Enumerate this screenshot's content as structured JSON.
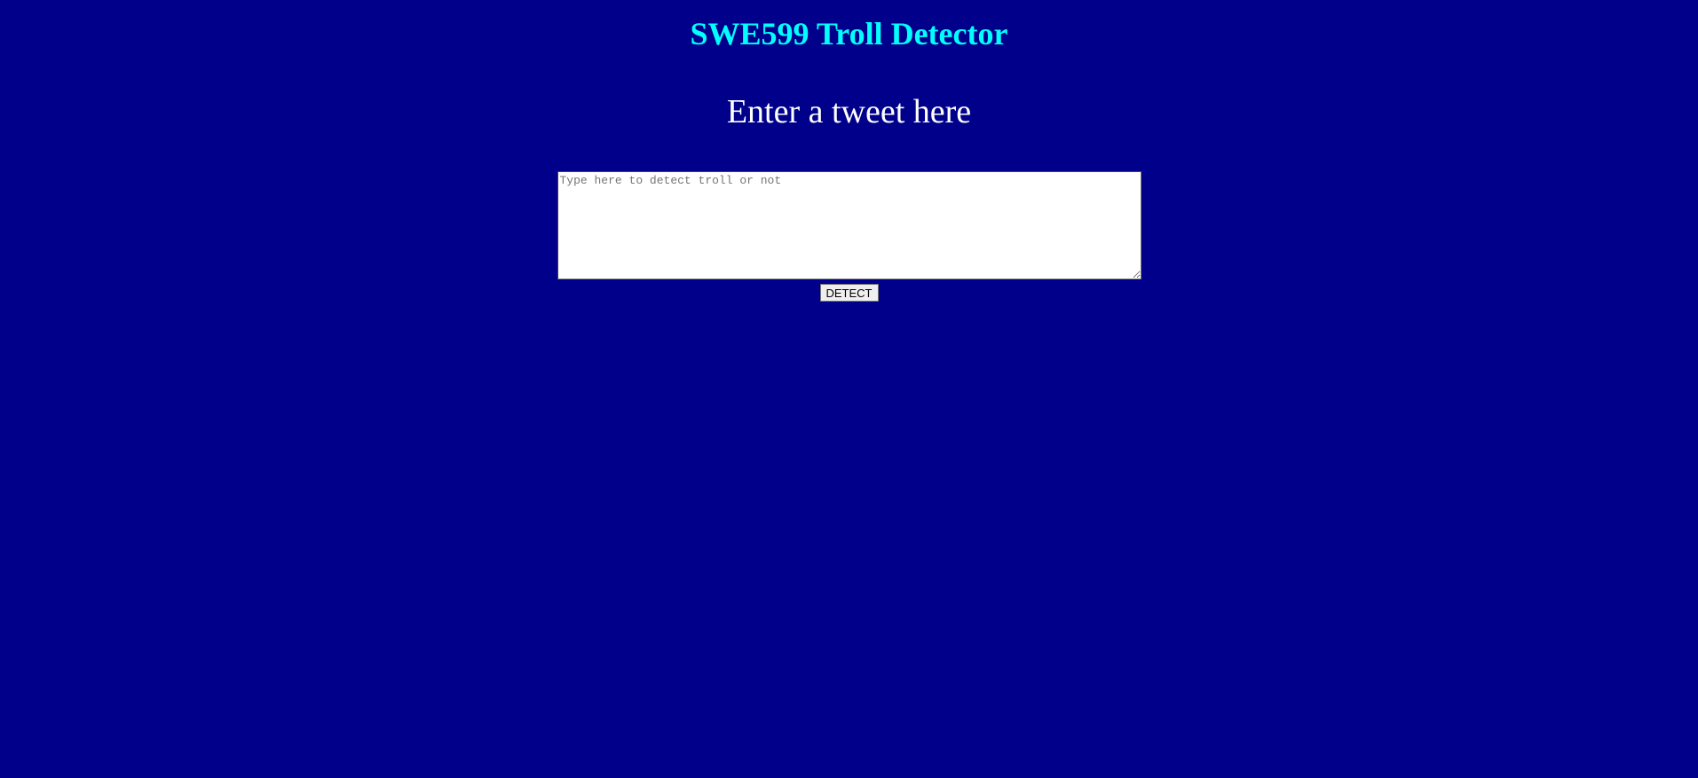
{
  "header": {
    "title": "SWE599 Troll Detector",
    "subtitle": "Enter a tweet here"
  },
  "form": {
    "tweet_input": {
      "value": "",
      "placeholder": "Type here to detect troll or not"
    },
    "detect_label": "DETECT"
  },
  "colors": {
    "background": "#00008b",
    "title": "#00ffff",
    "subtitle": "#ffffff"
  }
}
